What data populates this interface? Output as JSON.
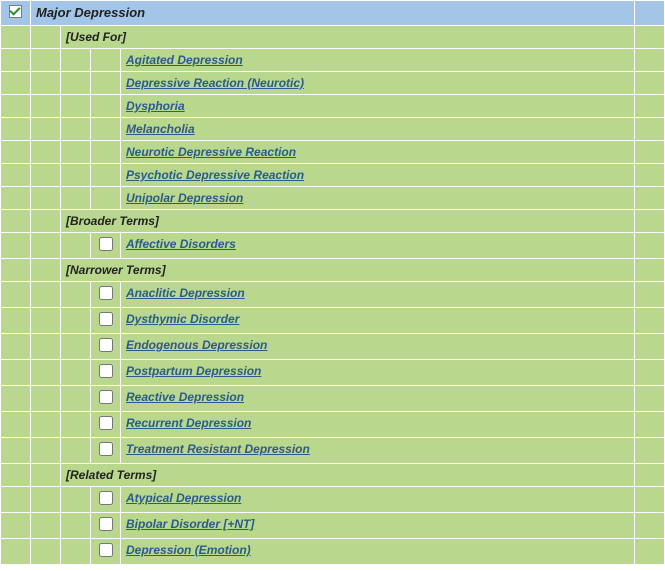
{
  "main": {
    "title": "Major Depression",
    "checked": true
  },
  "sections": [
    {
      "label": "[Used For]",
      "hasCheckboxes": false,
      "terms": [
        "Agitated Depression",
        "Depressive Reaction (Neurotic)",
        "Dysphoria",
        "Melancholia",
        "Neurotic Depressive Reaction",
        "Psychotic Depressive Reaction",
        "Unipolar Depression"
      ]
    },
    {
      "label": "[Broader Terms]",
      "hasCheckboxes": true,
      "terms": [
        "Affective Disorders"
      ]
    },
    {
      "label": "[Narrower Terms]",
      "hasCheckboxes": true,
      "terms": [
        "Anaclitic Depression",
        "Dysthymic Disorder",
        "Endogenous Depression",
        "Postpartum Depression",
        "Reactive Depression",
        "Recurrent Depression",
        "Treatment Resistant Depression"
      ]
    },
    {
      "label": "[Related Terms]",
      "hasCheckboxes": true,
      "terms": [
        "Atypical Depression",
        "Bipolar Disorder [+NT]",
        "Depression (Emotion)"
      ]
    }
  ]
}
